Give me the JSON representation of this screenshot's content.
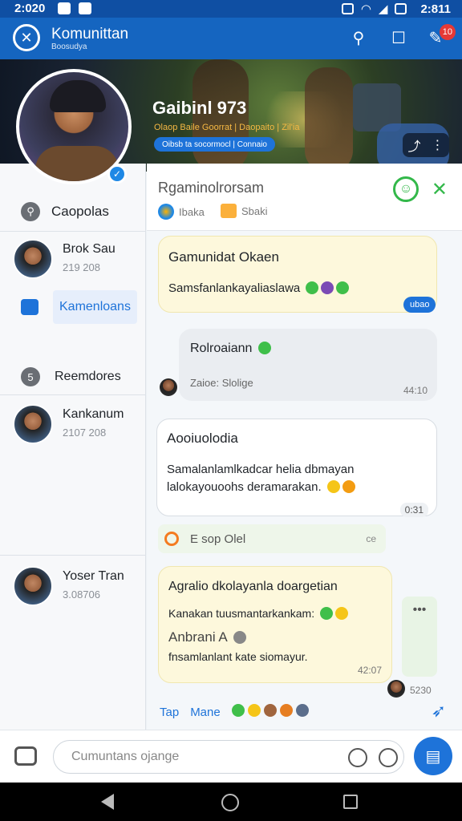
{
  "status_bar": {
    "time": "2:020",
    "time_right": "2:811"
  },
  "app_bar": {
    "title": "Komunittan",
    "subtitle": "Boosudya",
    "notification_count": "10"
  },
  "hero": {
    "title": "Gaibinl 973",
    "tagline": "Olaop Baile Goorrat | Daopaito | Zil'ia",
    "pill": "Oibsb ta socormocl | Connaio"
  },
  "sidebar": {
    "header": "Caopolas",
    "contacts": [
      {
        "name": "Brok Sau",
        "sub": "219 208"
      },
      {
        "name": "Kankanum",
        "sub": "2107 208"
      },
      {
        "name": "Yoser Tran",
        "sub": "3.08706"
      }
    ],
    "active_item": "Kamenloans",
    "section": "Reemdores"
  },
  "chat": {
    "title": "Rgaminolrorsam",
    "tag1": "Ibaka",
    "tag2": "Sbaki",
    "messages": [
      {
        "title": "Gamunidat Okaen",
        "text": "Samsfanlankayaliaslawa",
        "time": "ubao"
      },
      {
        "title": "Rolroaiann",
        "text": "Zaioe: Slolige",
        "time": "44:10"
      },
      {
        "title": "Aooiuolodia",
        "line1": "Samalanlamlkadcar helia dbmayan",
        "line2": "lalokayouoohs deramarakan.",
        "time": "0:31"
      },
      {
        "system": "E sop Olel",
        "end": "ce"
      },
      {
        "title": "Agralio dkolayanla doargetian",
        "line1": "Kanakan tuusmantarkankam:",
        "line2": "Anbrani A",
        "line3": "fnsamlanlant kate siomayur.",
        "time": "42:07"
      }
    ],
    "outgoing_time": "5230",
    "side_more": "•••",
    "quick_actions": [
      "Tap",
      "Mane"
    ]
  },
  "input": {
    "placeholder": "Cumuntans ojange"
  }
}
